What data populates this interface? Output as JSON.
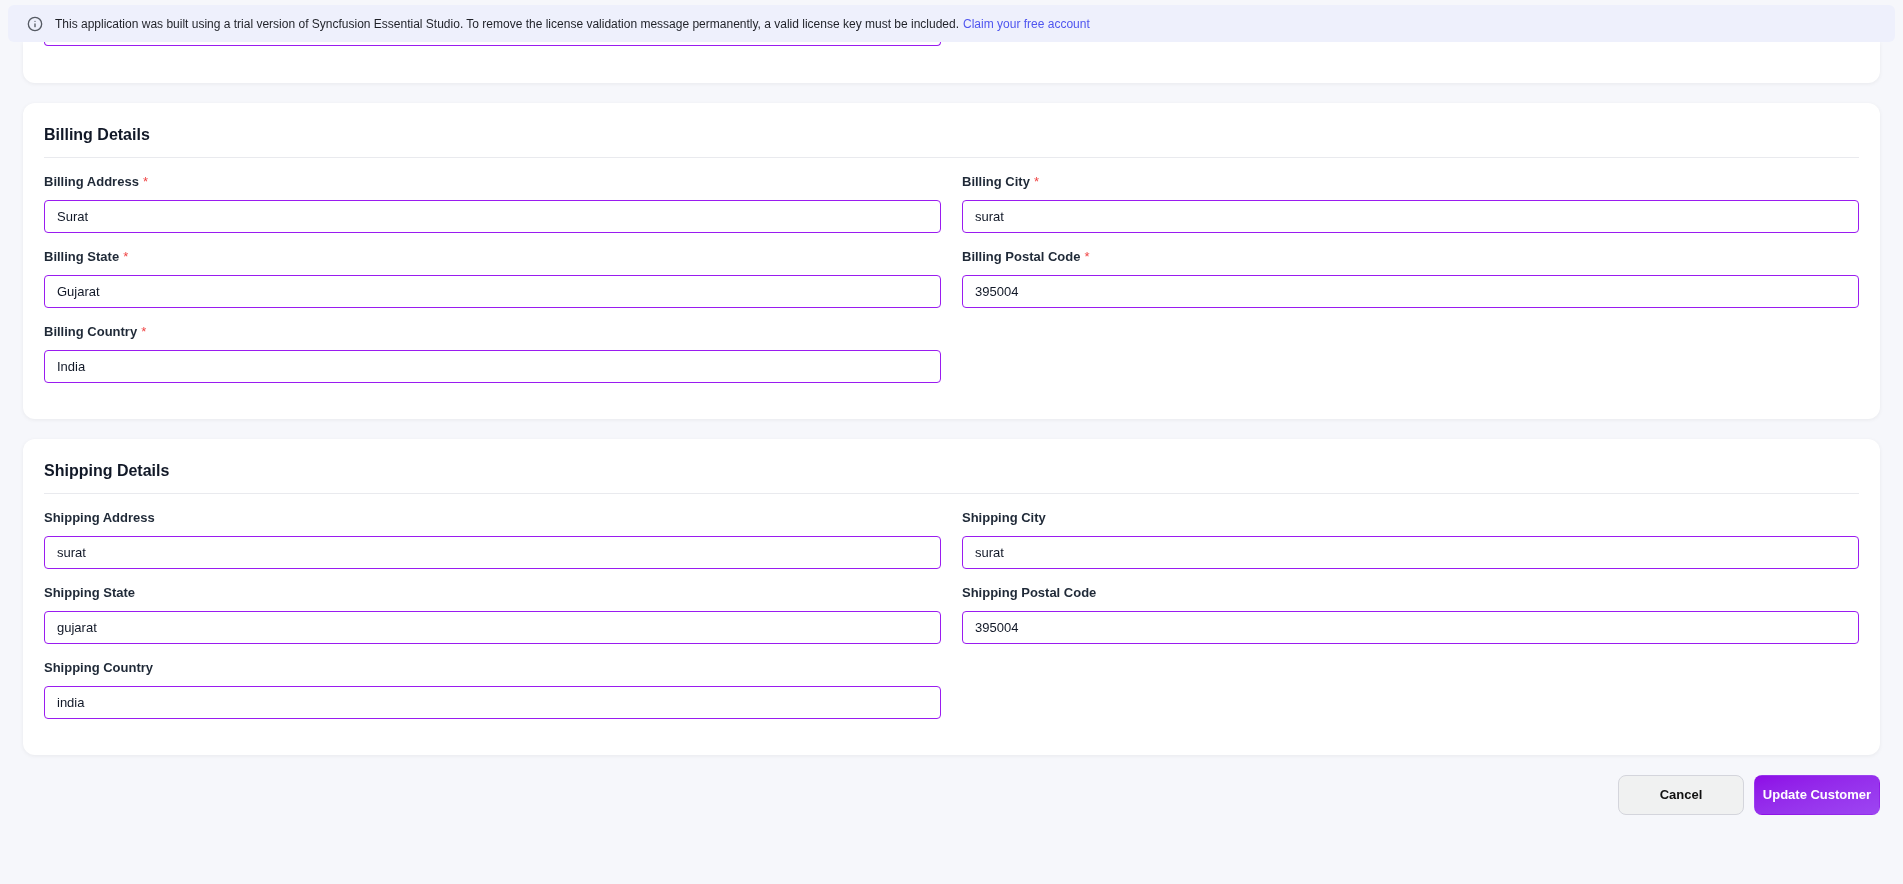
{
  "license_banner": {
    "message": "This application was built using a trial version of Syncfusion Essential Studio. To remove the license validation message permanently, a valid license key must be included.",
    "link": "Claim your free account"
  },
  "sections": [
    {
      "title": "Billing Details",
      "fields": [
        {
          "label": "Billing Address",
          "required_mark": "*",
          "value": "Surat"
        },
        {
          "label": "Billing City",
          "required_mark": "*",
          "value": "surat"
        },
        {
          "label": "Billing State",
          "required_mark": "*",
          "value": "Gujarat"
        },
        {
          "label": "Billing Postal Code",
          "required_mark": "*",
          "value": "395004"
        },
        {
          "label": "Billing Country",
          "required_mark": "*",
          "value": "India"
        }
      ]
    },
    {
      "title": "Shipping Details",
      "fields": [
        {
          "label": "Shipping Address",
          "value": "surat"
        },
        {
          "label": "Shipping City",
          "value": "surat"
        },
        {
          "label": "Shipping State",
          "value": "gujarat"
        },
        {
          "label": "Shipping Postal Code",
          "value": "395004"
        },
        {
          "label": "Shipping Country",
          "value": "india"
        }
      ]
    }
  ],
  "buttons": [
    {
      "label": "Cancel",
      "kind": "secondary"
    },
    {
      "label": "Update Customer",
      "kind": "primary"
    }
  ]
}
